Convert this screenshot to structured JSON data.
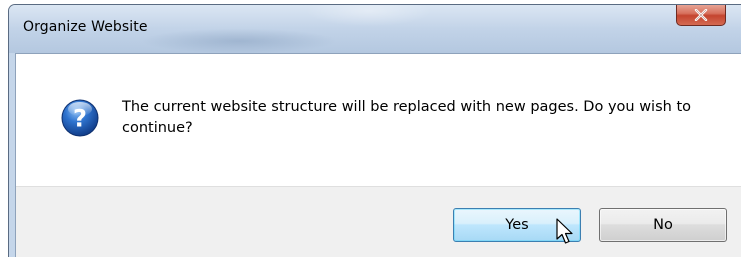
{
  "window": {
    "title": "Organize Website",
    "close_icon": "close-x-icon"
  },
  "message": {
    "icon": "question-icon",
    "text": "The current website structure will be replaced with new pages.  Do you wish to continue?"
  },
  "buttons": {
    "yes_label": "Yes",
    "no_label": "No"
  },
  "colors": {
    "close_button": "#c4442f",
    "question_icon": "#1f5fb8",
    "yes_focus_border": "#3c7fb1"
  }
}
